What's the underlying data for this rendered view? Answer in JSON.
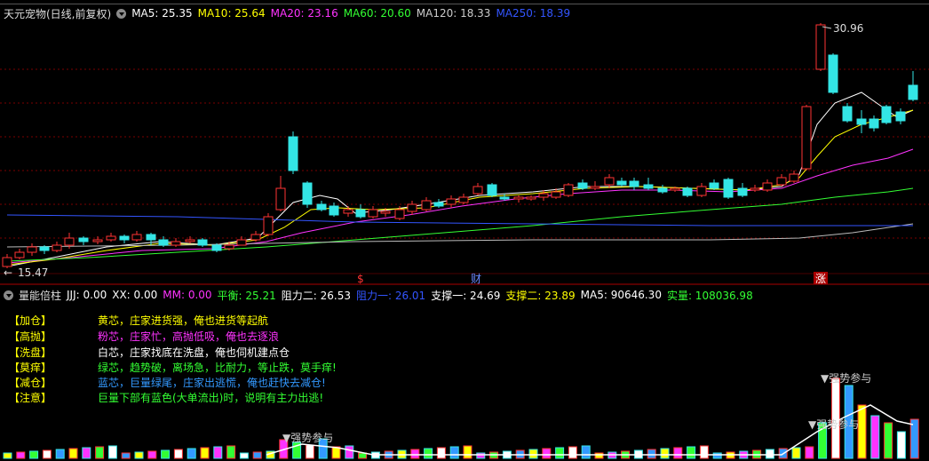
{
  "main_header": {
    "title": "天元宠物(日线,前复权)",
    "ma": [
      {
        "label": "MA5: 25.35",
        "color": "#ffffff"
      },
      {
        "label": "MA10: 25.64",
        "color": "#ffff00"
      },
      {
        "label": "MA20: 23.16",
        "color": "#ff33ff"
      },
      {
        "label": "MA60: 20.60",
        "color": "#33ff33"
      },
      {
        "label": "MA120: 18.33",
        "color": "#cccccc"
      },
      {
        "label": "MA250: 18.39",
        "color": "#3355ff"
      }
    ]
  },
  "price_labels": {
    "high": "30.96",
    "low": "15.47"
  },
  "markers": [
    {
      "label": "$",
      "color": "#ff3333"
    },
    {
      "label": "财",
      "color": "#6688ff"
    },
    {
      "label": "涨",
      "color": "#ffffff"
    }
  ],
  "sub_header": {
    "title": "量能倍柱",
    "items": [
      {
        "label": "JJJ: 0.00",
        "color": "#ffffff"
      },
      {
        "label": "XX: 0.00",
        "color": "#ffffff"
      },
      {
        "label": "MM: 0.00",
        "color": "#ff33ff"
      },
      {
        "label": "平衡: 25.21",
        "color": "#33ff33"
      },
      {
        "label": "阻力二: 26.53",
        "color": "#ffffff"
      },
      {
        "label": "阻力一: 26.01",
        "color": "#3355ff"
      },
      {
        "label": "支撑一: 24.69",
        "color": "#ffffff"
      },
      {
        "label": "支撑二: 23.89",
        "color": "#ffff00"
      },
      {
        "label": "MA5: 90646.30",
        "color": "#ffffff"
      },
      {
        "label": "实量: 108036.98",
        "color": "#33ff33"
      }
    ]
  },
  "legend": [
    {
      "tag": "【加仓】",
      "text": "黄芯，庄家进货强，俺也进货等起航",
      "color": "#ffff00"
    },
    {
      "tag": "【高抛】",
      "text": "粉芯，庄家忙，高抛低吸，俺也去逐浪",
      "color": "#ff33ff"
    },
    {
      "tag": "【洗盘】",
      "text": "白芯，庄家找底在洗盘，俺也伺机建点仓",
      "color": "#ffffff"
    },
    {
      "tag": "【莫痒】",
      "text": "绿芯，趋势破，离场急，比耐力，等止跌，莫手痒!",
      "color": "#33ff33"
    },
    {
      "tag": "【减仓】",
      "text": "蓝芯，巨量绿尾，庄家出逃慌，俺也赶快去减仓!",
      "color": "#3399ff"
    },
    {
      "tag": "【注意】",
      "text": "巨量下部有蓝色(大单流出)时，说明有主力出逃!",
      "color": "#33ff33"
    }
  ],
  "volume_labels": {
    "strong1": "▼强势参与",
    "strong2": "▼强势参与",
    "strong3": "▼强势参与"
  }
}
